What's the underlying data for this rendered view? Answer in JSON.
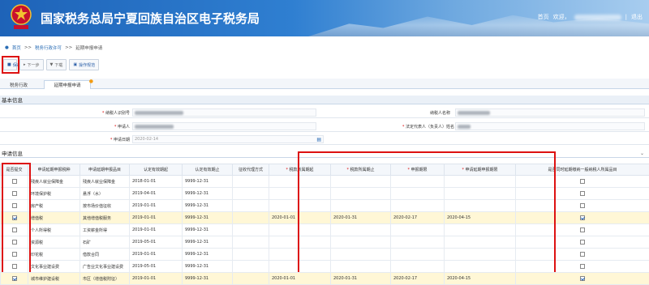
{
  "header": {
    "title": "国家税务总局宁夏回族自治区电子税务局",
    "links": [
      "首页",
      "欢迎，",
      "退出"
    ]
  },
  "breadcrumb": [
    "首页",
    "税务行政许可",
    "延期申报申请"
  ],
  "toolbar": {
    "save": "保存",
    "next": "下一步",
    "print": "下载",
    "guide": "操作规范"
  },
  "tabs": [
    "税务行政",
    "延期申报申请"
  ],
  "basic": {
    "section": "基本信息",
    "taxpayer_id_label": "纳税人识别号",
    "taxpayer_name_label": "纳税人名称",
    "applicant_label": "申请人",
    "legal_rep_label": "法定代表人（负责人）姓名",
    "apply_date_label": "申请日期",
    "apply_date": "2020-02-14"
  },
  "apply": {
    "section": "申请信息",
    "columns": [
      "是否提交",
      "申请延期申报税种",
      "申请延期申报品目",
      "认定有效期起",
      "认定有效期止",
      "征收代理方式",
      "税款所属期起",
      "税款所属期止",
      "申报期限",
      "申请延期申报期限",
      "是否同时延期缴纳一般纳税人所属品目"
    ],
    "rows": [
      {
        "checked": false,
        "tax": "残疾人就业保障金",
        "item": "残疾人就业保障金",
        "from": "2018-01-01",
        "to": "9999-12-31",
        "p1": "",
        "p2": "",
        "p3": "",
        "p4": "",
        "last": false
      },
      {
        "checked": false,
        "tax": "环境保护税",
        "item": "悬浮（水）",
        "from": "2019-04-01",
        "to": "9999-12-31",
        "p1": "",
        "p2": "",
        "p3": "",
        "p4": "",
        "last": false
      },
      {
        "checked": false,
        "tax": "房产税",
        "item": "按市场价值征收",
        "from": "2019-01-01",
        "to": "9999-12-31",
        "p1": "",
        "p2": "",
        "p3": "",
        "p4": "",
        "last": false
      },
      {
        "checked": true,
        "tax": "增值税",
        "item": "其他增值税服务",
        "from": "2019-01-01",
        "to": "9999-12-31",
        "p1": "2020-01-01",
        "p2": "2020-01-31",
        "p3": "2020-02-17",
        "p4": "2020-04-15",
        "last": true
      },
      {
        "checked": false,
        "tax": "个人所得税",
        "item": "工资薪金所得",
        "from": "2019-01-01",
        "to": "9999-12-31",
        "p1": "",
        "p2": "",
        "p3": "",
        "p4": "",
        "last": false
      },
      {
        "checked": false,
        "tax": "资源税",
        "item": "石矿",
        "from": "2019-05-01",
        "to": "9999-12-31",
        "p1": "",
        "p2": "",
        "p3": "",
        "p4": "",
        "last": false
      },
      {
        "checked": false,
        "tax": "印花税",
        "item": "借款合同",
        "from": "2019-01-01",
        "to": "9999-12-31",
        "p1": "",
        "p2": "",
        "p3": "",
        "p4": "",
        "last": false
      },
      {
        "checked": false,
        "tax": "文化事业建设费",
        "item": "广告业文化事业建设费",
        "from": "2019-05-01",
        "to": "9999-12-31",
        "p1": "",
        "p2": "",
        "p3": "",
        "p4": "",
        "last": false
      },
      {
        "checked": true,
        "tax": "城市维护建设税",
        "item": "市区（增值税附征）",
        "from": "2019-01-01",
        "to": "9999-12-31",
        "p1": "2020-01-01",
        "p2": "2020-01-31",
        "p3": "2020-02-17",
        "p4": "2020-04-15",
        "last": true
      }
    ]
  }
}
